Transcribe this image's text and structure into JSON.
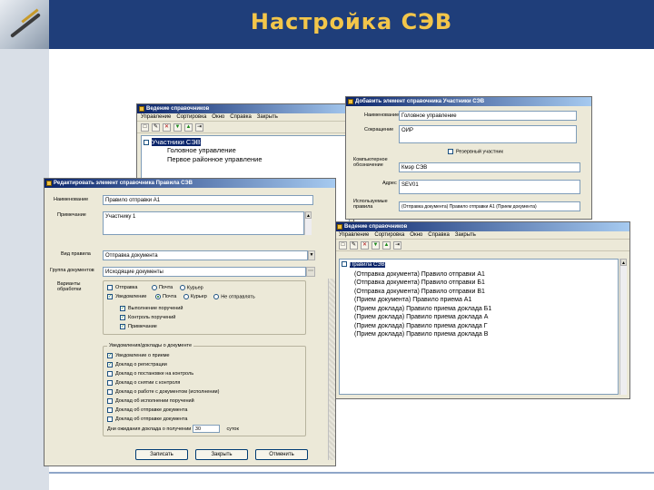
{
  "slide": {
    "title": "Настройка СЭВ",
    "colors": {
      "header": "#1f3e7a",
      "title": "#f3c64a",
      "titlebar": "#0a246a"
    }
  },
  "win1": {
    "title": "Ведение справочников",
    "menu": [
      "Управление",
      "Сортировка",
      "Окно",
      "Справка",
      "Закрыть"
    ],
    "node": "Участники СЭВ",
    "items": [
      "Головное управление",
      "Первое районное управление"
    ]
  },
  "win2": {
    "title": "Добавить элемент справочника Участники СЭВ",
    "labels": {
      "name": "Наименование",
      "short": "Сокращение",
      "location": "Компьютерное обозначение",
      "address": "Адрес",
      "used_rules": "Используемые правила"
    },
    "values": {
      "name": "Головное управление",
      "short": "ОИР",
      "location": "Кмэр СЭВ",
      "address": "SEV01",
      "used_rules": "(Отправка документа) Правило отправки А1 (Прием документа)"
    },
    "checkbox": "Резервный участник"
  },
  "win3": {
    "title": "Редактировать элемент справочника Правила СЭВ",
    "labels": {
      "name": "Наименование",
      "note": "Примечание",
      "doc_kind": "Вид правила",
      "doc_group": "Группа документов",
      "process": "Варианты обработки"
    },
    "values": {
      "name": "Правило отправки А1",
      "note": "Участнику 1",
      "doc_kind": "Отправка документа",
      "doc_group": "Исходящие документы"
    },
    "process_rows": [
      {
        "check": "Отправка",
        "radios": [
          "Почта",
          "Курьер"
        ]
      },
      {
        "check": "Уведомление",
        "radios": [
          "Почта",
          "Курьер",
          "Не отправлять"
        ]
      }
    ],
    "sub_checks": [
      "Выполнение поручений",
      "Контроль поручений",
      "Примечание"
    ],
    "group_title": "Уведомления/доклады о документе",
    "group_checks": [
      {
        "label": "Уведомление о приеме",
        "checked": true
      },
      {
        "label": "Доклад о регистрации",
        "checked": true
      },
      {
        "label": "Доклад о постановке на контроль",
        "checked": false
      },
      {
        "label": "Доклад о снятии с контроля",
        "checked": false
      },
      {
        "label": "Доклад о работе с документом (исполнении)",
        "checked": false
      },
      {
        "label": "Доклад об исполнении поручений",
        "checked": false
      },
      {
        "label": "Доклад об отправке документа",
        "checked": false
      },
      {
        "label": "Доклад об отправке документа",
        "checked": false
      }
    ],
    "days_label": "Дни ожидания доклада о получении",
    "days_value": "30",
    "days_unit": "суток",
    "buttons": [
      "Записать",
      "Закрыть",
      "Отменить"
    ]
  },
  "win4": {
    "title": "Ведение справочников",
    "menu": [
      "Управление",
      "Сортировка",
      "Окно",
      "Справка",
      "Закрыть"
    ],
    "node": "Правила СЭВ",
    "rows": [
      "(Отправка документа) Правило отправки А1",
      "(Отправка документа) Правило отправки Б1",
      "(Отправка документа) Правило отправки В1",
      "(Прием документа) Правило приема А1",
      "(Прием доклада) Правило приема доклада Б1",
      "(Прием доклада) Правило приема доклада А",
      "(Прием доклада) Правило приема доклада Г",
      "(Прием доклада) Правило приема доклада В"
    ]
  }
}
